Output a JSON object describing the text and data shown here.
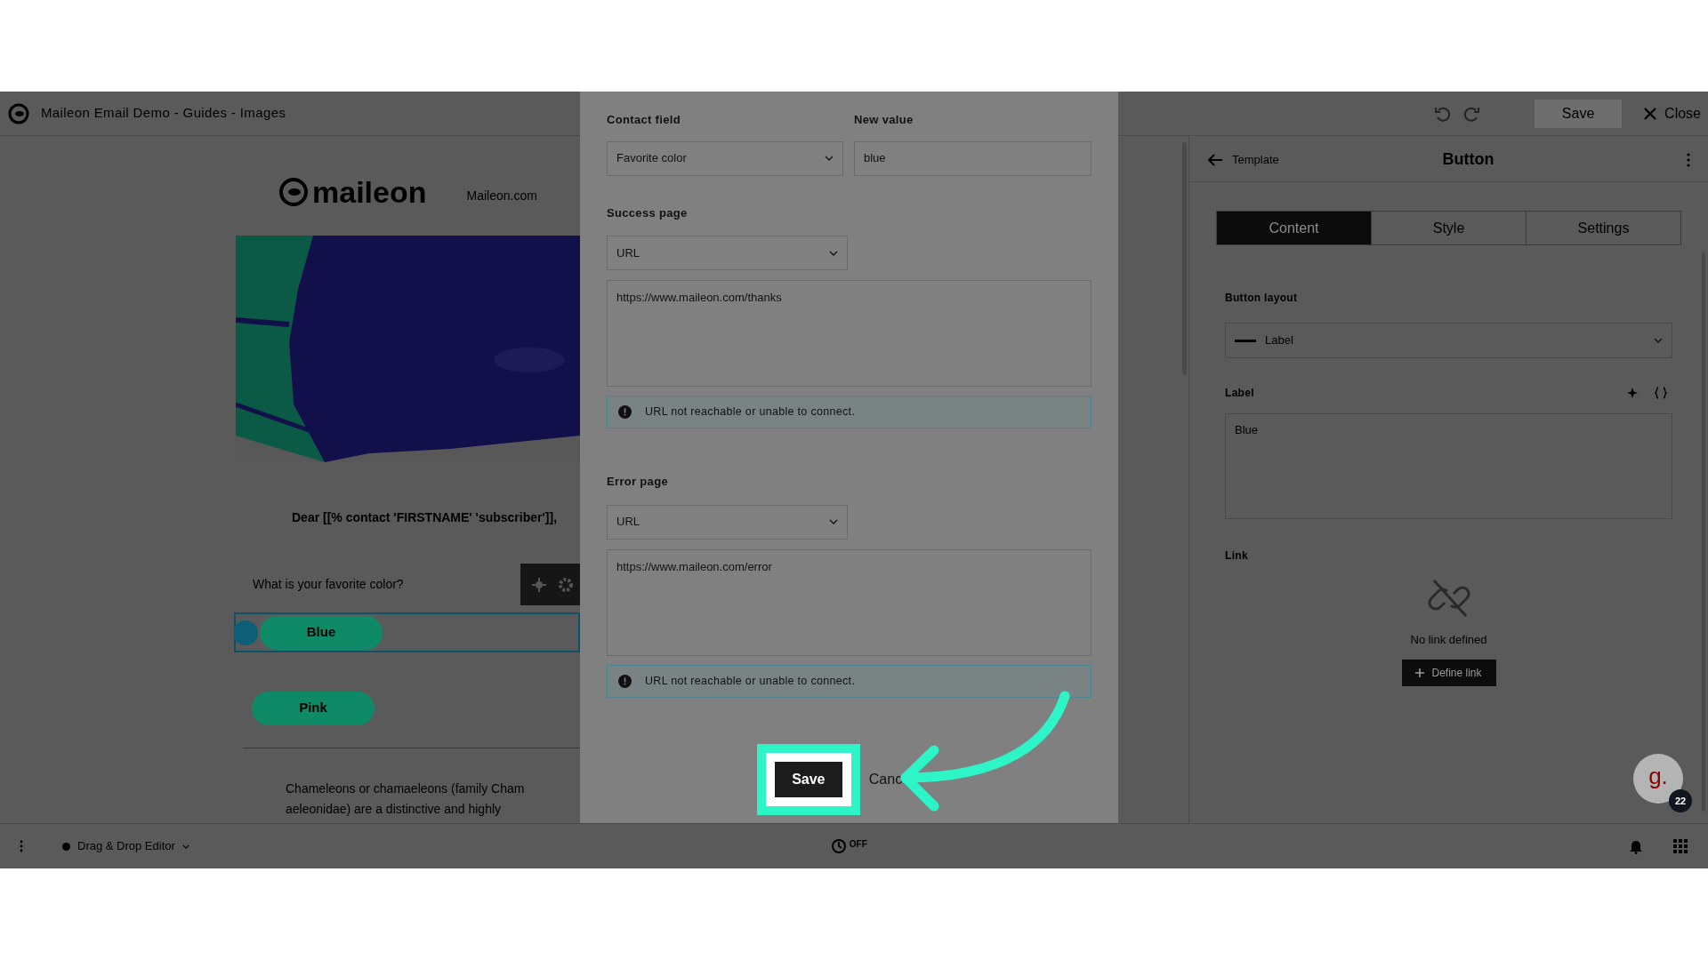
{
  "app_bar": {
    "title": "Maileon Email Demo - Guides - Images",
    "save": "Save",
    "close": "Close"
  },
  "email": {
    "logo": "maileon",
    "link": "Maileon.com",
    "hero": {
      "kind": "picture"
    },
    "greeting": "Dear [[% contact 'FIRSTNAME' 'subscriber']],",
    "question": "What is your favorite color?",
    "options": [
      {
        "label": "Blue",
        "selected": true
      },
      {
        "label": "Pink",
        "selected": false
      }
    ],
    "paragraph_lines": [
      "Chameleons or chamaeleons (family Cham",
      "aeleonidae) are a distinctive and highly"
    ]
  },
  "dialog": {
    "contact_field": {
      "label": "Contact field",
      "value": "Favorite color"
    },
    "new_value": {
      "label": "New value",
      "value": "blue"
    },
    "sections": [
      {
        "label": "Success page",
        "type": "URL",
        "url": "https://www.maileon.com/thanks",
        "alert": "URL not reachable or unable to connect."
      },
      {
        "label": "Error page",
        "type": "URL",
        "url": "https://www.maileon.com/error",
        "alert": "URL not reachable or unable to connect."
      }
    ],
    "save": "Save",
    "cancel": "Canc"
  },
  "panel": {
    "back": "Template",
    "title": "Button",
    "tabs": [
      {
        "label": "Content",
        "selected": true
      },
      {
        "label": "Style",
        "selected": false
      },
      {
        "label": "Settings",
        "selected": false
      }
    ],
    "layout_label": "Button layout",
    "layout_value": "Label",
    "label_label": "Label",
    "label_value": "Blue",
    "link_label": "Link",
    "link_empty": "No link defined",
    "define_link": "Define link"
  },
  "bottom_bar": {
    "editor": "Drag & Drop Editor",
    "toggle": "OFF"
  },
  "guide": {
    "logo": "g.",
    "badge": "22"
  }
}
